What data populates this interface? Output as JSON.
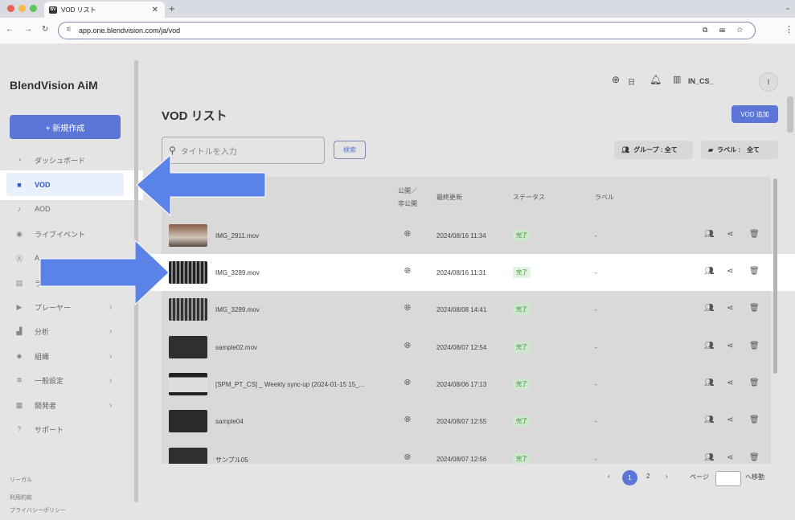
{
  "browser": {
    "tab_title": "VOD リスト",
    "tab_favicon": "BV",
    "url": "app.one.blendvision.com/ja/vod",
    "dot_colors": [
      "#ec5f57",
      "#f4bd4f",
      "#61c454"
    ]
  },
  "sidebar": {
    "logo": "BlendVision AiM",
    "new_button": "+ 新規作成",
    "items": [
      {
        "label": "ダッシュボード",
        "icon": "speedometer-icon"
      },
      {
        "label": "VOD",
        "icon": "video-icon"
      },
      {
        "label": "AOD",
        "icon": "music-note-icon"
      },
      {
        "label": "ライブイベント",
        "icon": "broadcast-icon"
      },
      {
        "label": "A",
        "icon": "ai-icon"
      },
      {
        "label": "ラ",
        "icon": "library-icon"
      },
      {
        "label": "プレーヤー",
        "icon": "player-icon"
      },
      {
        "label": "分析",
        "icon": "chart-icon"
      },
      {
        "label": "組織",
        "icon": "people-icon"
      },
      {
        "label": "一般設定",
        "icon": "gear-icon"
      },
      {
        "label": "開発者",
        "icon": "grid-icon"
      },
      {
        "label": "サポート",
        "icon": "help-icon"
      }
    ],
    "footer": [
      "リーガル",
      "利用約款",
      "プライバシーポリシー"
    ]
  },
  "header": {
    "language": "日",
    "org": "IN_CS_",
    "avatar": "I"
  },
  "main": {
    "title": "VOD リスト",
    "add_button": "VOD 追加",
    "search_placeholder": "タイトルを入力",
    "search_button": "検索",
    "filter_group": "グループ : 全て",
    "filter_label": "ラベル :　全て",
    "columns": {
      "public_line1": "公開／",
      "public_line2": "非公開",
      "updated": "最終更新",
      "status": "ステータス",
      "label": "ラベル"
    },
    "rows": [
      {
        "name": "IMG_2911.mov",
        "date": "2024/08/16 11:34",
        "status": "完了",
        "label": "-"
      },
      {
        "name": "IMG_3289.mov",
        "date": "2024/08/16 11:31",
        "status": "完了",
        "label": "-"
      },
      {
        "name": "IMG_3289.mov",
        "date": "2024/08/08 14:41",
        "status": "完了",
        "label": "-"
      },
      {
        "name": "sample02.mov",
        "date": "2024/08/07 12:54",
        "status": "完了",
        "label": "-"
      },
      {
        "name": "[SPM_PT_CS] _ Weekly sync-up (2024-01-15 15_...",
        "date": "2024/08/06 17:13",
        "status": "完了",
        "label": "-"
      },
      {
        "name": "sample04",
        "date": "2024/08/07 12:55",
        "status": "完了",
        "label": "-"
      },
      {
        "name": "サンプル05",
        "date": "2024/08/07 12:56",
        "status": "完了",
        "label": "-"
      }
    ],
    "pagination": {
      "prev": "‹",
      "page1": "1",
      "page2": "2",
      "next": "›",
      "page_label": "ページ",
      "go": "へ移動"
    }
  },
  "colors": {
    "accent": "#5b76d6",
    "arrow": "#5b82e6"
  }
}
